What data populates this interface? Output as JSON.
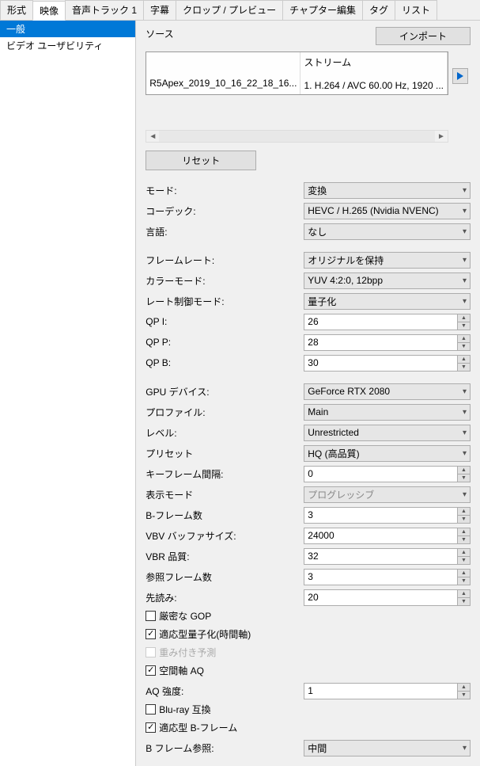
{
  "tabs": [
    "形式",
    "映像",
    "音声トラック 1",
    "字幕",
    "クロップ / プレビュー",
    "チャプター編集",
    "タグ",
    "リスト"
  ],
  "active_tab_index": 1,
  "sidebar": {
    "items": [
      "一般",
      "ビデオ ユーザビリティ"
    ],
    "selected_index": 0
  },
  "source": {
    "label": "ソース",
    "import_label": "インポート",
    "filename": "R5Apex_2019_10_16_22_18_16...",
    "stream_header": "ストリーム",
    "stream_value": "1. H.264 / AVC  60.00 Hz, 1920 ..."
  },
  "reset_label": "リセット",
  "fields": {
    "mode": {
      "label": "モード:",
      "value": "変換"
    },
    "codec": {
      "label": "コーデック:",
      "value": "HEVC / H.265 (Nvidia NVENC)"
    },
    "language": {
      "label": "言語:",
      "value": "なし"
    },
    "framerate": {
      "label": "フレームレート:",
      "value": "オリジナルを保持"
    },
    "colormode": {
      "label": "カラーモード:",
      "value": "YUV 4:2:0, 12bpp"
    },
    "ratecontrol": {
      "label": "レート制御モード:",
      "value": "量子化"
    },
    "qpi": {
      "label": "QP I:",
      "value": "26"
    },
    "qpp": {
      "label": "QP P:",
      "value": "28"
    },
    "qpb": {
      "label": "QP B:",
      "value": "30"
    },
    "gpu": {
      "label": "GPU デバイス:",
      "value": "GeForce RTX 2080"
    },
    "profile": {
      "label": "プロファイル:",
      "value": "Main"
    },
    "level": {
      "label": "レベル:",
      "value": "Unrestricted"
    },
    "preset": {
      "label": "プリセット",
      "value": "HQ (高品質)"
    },
    "keyframe": {
      "label": "キーフレーム間隔:",
      "value": "0"
    },
    "display": {
      "label": "表示モード",
      "value": "プログレッシブ"
    },
    "bframes": {
      "label": "B-フレーム数",
      "value": "3"
    },
    "vbvbuf": {
      "label": "VBV バッファサイズ:",
      "value": "24000"
    },
    "vbrquality": {
      "label": "VBR 品質:",
      "value": "32"
    },
    "refframes": {
      "label": "参照フレーム数",
      "value": "3"
    },
    "lookahead": {
      "label": "先読み:",
      "value": "20"
    },
    "aqstrength": {
      "label": "AQ 強度:",
      "value": "1"
    },
    "bframeref": {
      "label": "B フレーム参照:",
      "value": "中間"
    }
  },
  "checkboxes": {
    "strict_gop": {
      "label": "厳密な GOP",
      "checked": false
    },
    "adaptive_quant": {
      "label": "適応型量子化(時間軸)",
      "checked": true
    },
    "weighted_pred": {
      "label": "重み付き予測",
      "checked": false,
      "disabled": true
    },
    "spatial_aq": {
      "label": "空間軸 AQ",
      "checked": true
    },
    "bluray": {
      "label": "Blu-ray 互換",
      "checked": false
    },
    "adaptive_bframe": {
      "label": "適応型 B-フレーム",
      "checked": true
    }
  }
}
